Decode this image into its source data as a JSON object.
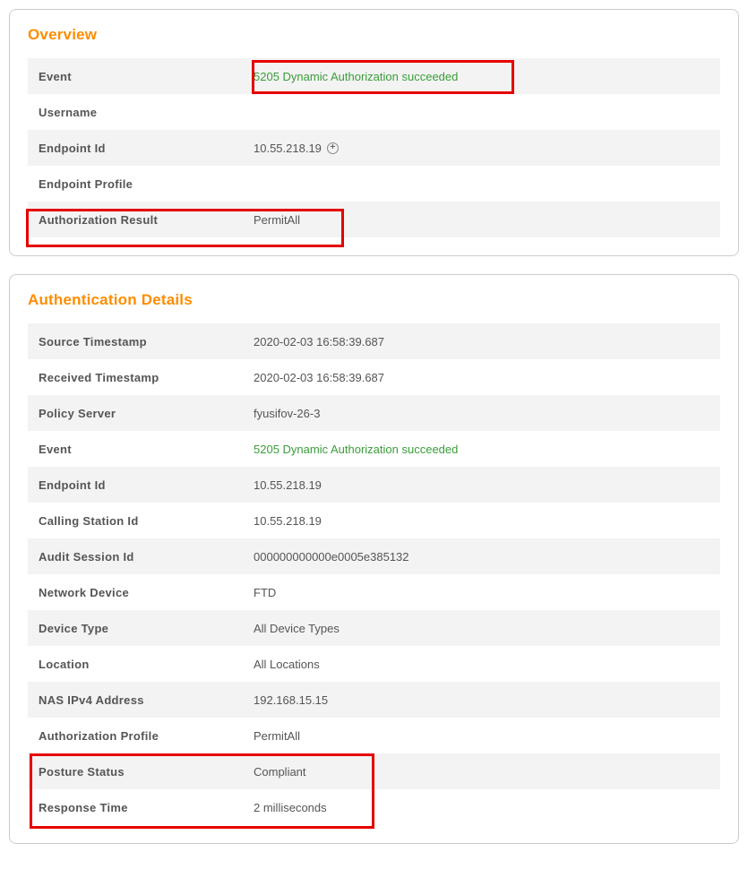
{
  "overview": {
    "title": "Overview",
    "rows": [
      {
        "label": "Event",
        "value": "5205 Dynamic Authorization succeeded",
        "green": true
      },
      {
        "label": "Username",
        "value": ""
      },
      {
        "label": "Endpoint Id",
        "value": "10.55.218.19",
        "expand": true
      },
      {
        "label": "Endpoint Profile",
        "value": ""
      },
      {
        "label": "Authorization Result",
        "value": "PermitAll"
      }
    ]
  },
  "details": {
    "title": "Authentication Details",
    "rows": [
      {
        "label": "Source Timestamp",
        "value": "2020-02-03 16:58:39.687"
      },
      {
        "label": "Received Timestamp",
        "value": "2020-02-03 16:58:39.687"
      },
      {
        "label": "Policy Server",
        "value": "fyusifov-26-3"
      },
      {
        "label": "Event",
        "value": "5205 Dynamic Authorization succeeded",
        "green": true
      },
      {
        "label": "Endpoint Id",
        "value": "10.55.218.19"
      },
      {
        "label": "Calling Station Id",
        "value": "10.55.218.19"
      },
      {
        "label": "Audit Session Id",
        "value": "000000000000e0005e385132"
      },
      {
        "label": "Network Device",
        "value": "FTD"
      },
      {
        "label": "Device Type",
        "value": "All Device Types"
      },
      {
        "label": "Location",
        "value": "All Locations"
      },
      {
        "label": "NAS IPv4 Address",
        "value": "192.168.15.15"
      },
      {
        "label": "Authorization Profile",
        "value": "PermitAll"
      },
      {
        "label": "Posture Status",
        "value": "Compliant"
      },
      {
        "label": "Response Time",
        "value": "2 milliseconds"
      }
    ]
  },
  "icons": {
    "expand": "+"
  }
}
